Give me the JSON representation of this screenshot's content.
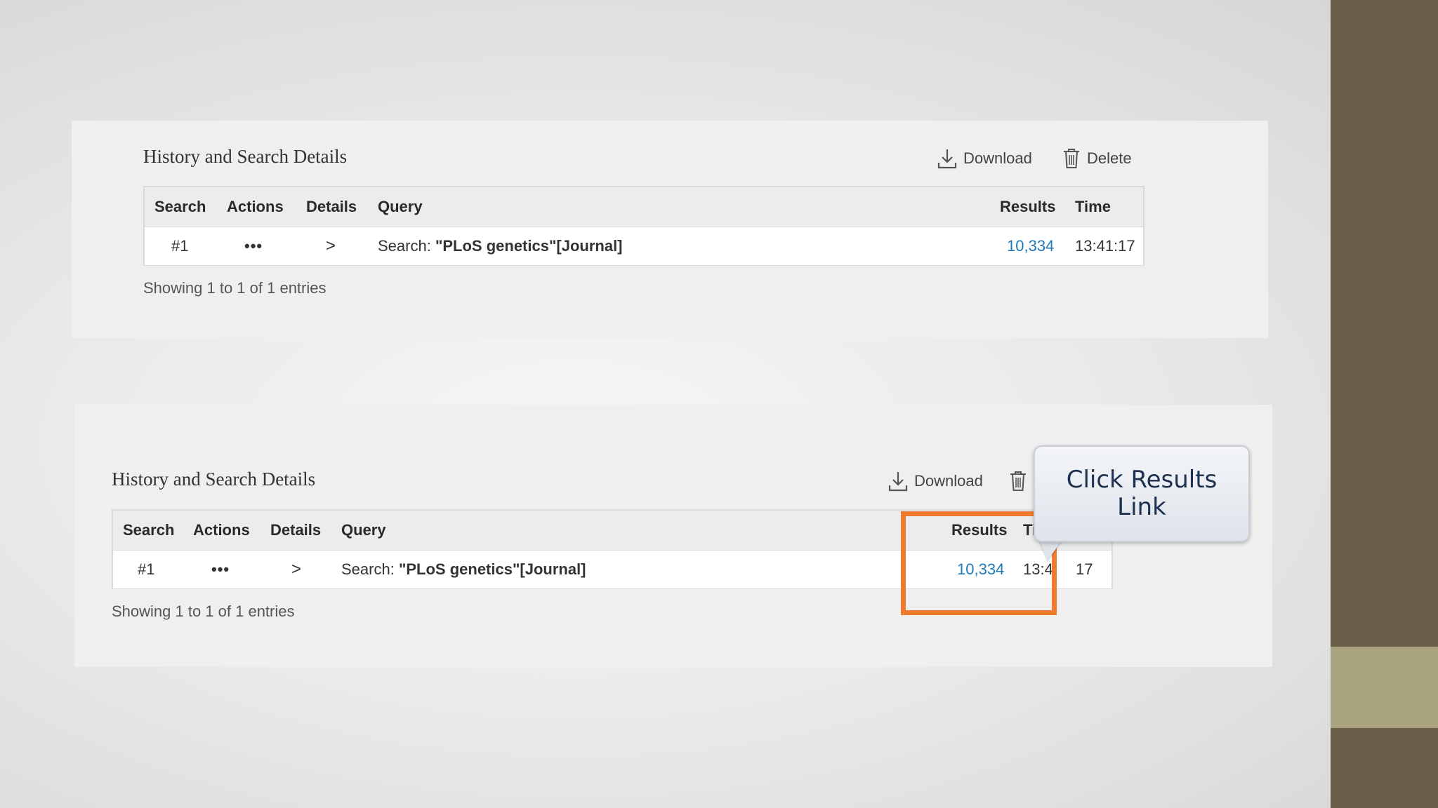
{
  "panels": [
    {
      "title": "History and Search Details",
      "download_label": "Download",
      "delete_label": "Delete",
      "columns": [
        "Search",
        "Actions",
        "Details",
        "Query",
        "Results",
        "Time"
      ],
      "row": {
        "search": "#1",
        "actions": "•••",
        "details": ">",
        "query_prefix": "Search: ",
        "query_term": "\"PLoS genetics\"[Journal]",
        "results": "10,334",
        "time": "13:41:17"
      },
      "entries": "Showing 1 to 1 of 1 entries"
    },
    {
      "title": "History and Search Details",
      "download_label": "Download",
      "columns": [
        "Search",
        "Actions",
        "Details",
        "Query",
        "Results",
        "Ti"
      ],
      "row": {
        "search": "#1",
        "actions": "•••",
        "details": ">",
        "query_prefix": "Search: ",
        "query_term": "\"PLoS genetics\"[Journal]",
        "results": "10,334",
        "time_left": "13:4",
        "time_right": "17"
      },
      "entries": "Showing 1 to 1 of 1 entries"
    }
  ],
  "callout": {
    "line1": "Click Results",
    "line2": "Link"
  },
  "colors": {
    "link": "#1f7ab8",
    "highlight": "#f07b2e",
    "sidebar_dark": "#6b5e48",
    "sidebar_light": "#a9a27f"
  },
  "icons": [
    "download-icon",
    "trash-icon"
  ]
}
